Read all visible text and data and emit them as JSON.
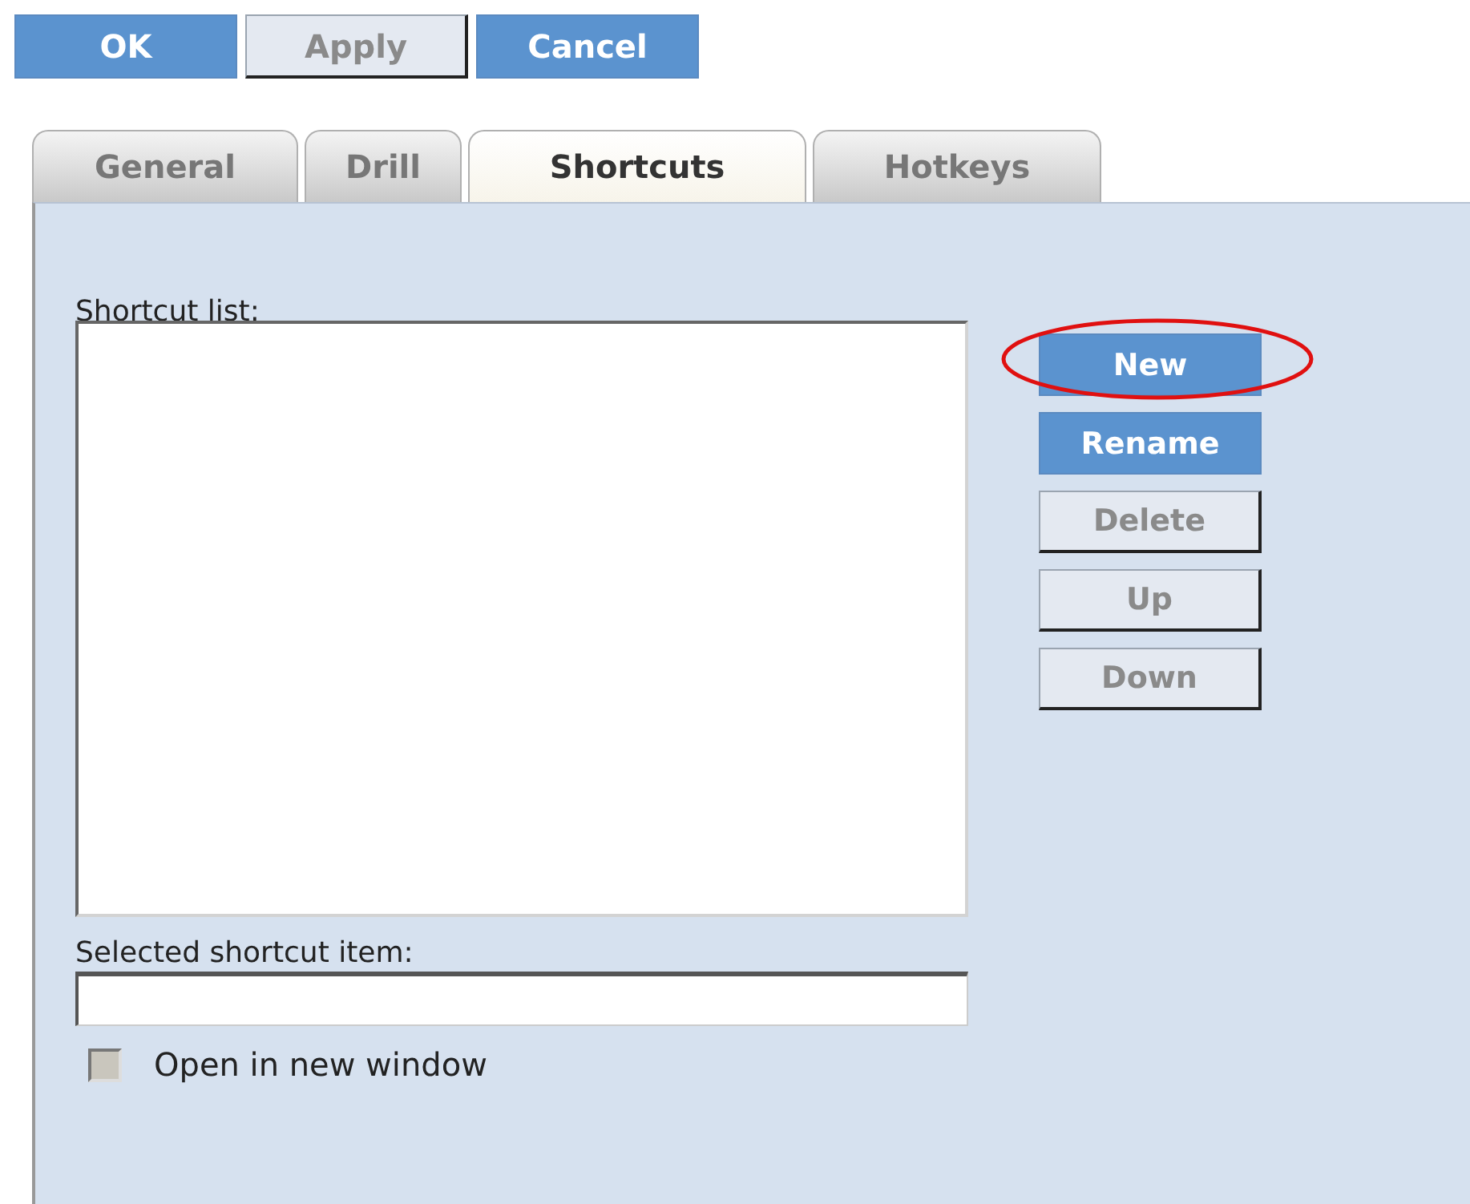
{
  "dialog_buttons": [
    {
      "label": "OK",
      "disabled": false
    },
    {
      "label": "Apply",
      "disabled": true
    },
    {
      "label": "Cancel",
      "disabled": false
    }
  ],
  "tabs": [
    {
      "label": "General",
      "selected": false
    },
    {
      "label": "Drill",
      "selected": false
    },
    {
      "label": "Shortcuts",
      "selected": true
    },
    {
      "label": "Hotkeys",
      "selected": false
    }
  ],
  "shortcut_list": {
    "label": "Shortcut list:"
  },
  "list_buttons": [
    {
      "label": "New",
      "disabled": false,
      "circled": true
    },
    {
      "label": "Rename",
      "disabled": false,
      "circled": false
    },
    {
      "label": "Delete",
      "disabled": true,
      "circled": false
    },
    {
      "label": "Up",
      "disabled": true,
      "circled": false
    },
    {
      "label": "Down",
      "disabled": true,
      "circled": false
    }
  ],
  "selected_item": {
    "label": "Selected shortcut item:"
  },
  "open_in_new_window": {
    "label": "Open in new window",
    "checked": false,
    "disabled": true
  }
}
